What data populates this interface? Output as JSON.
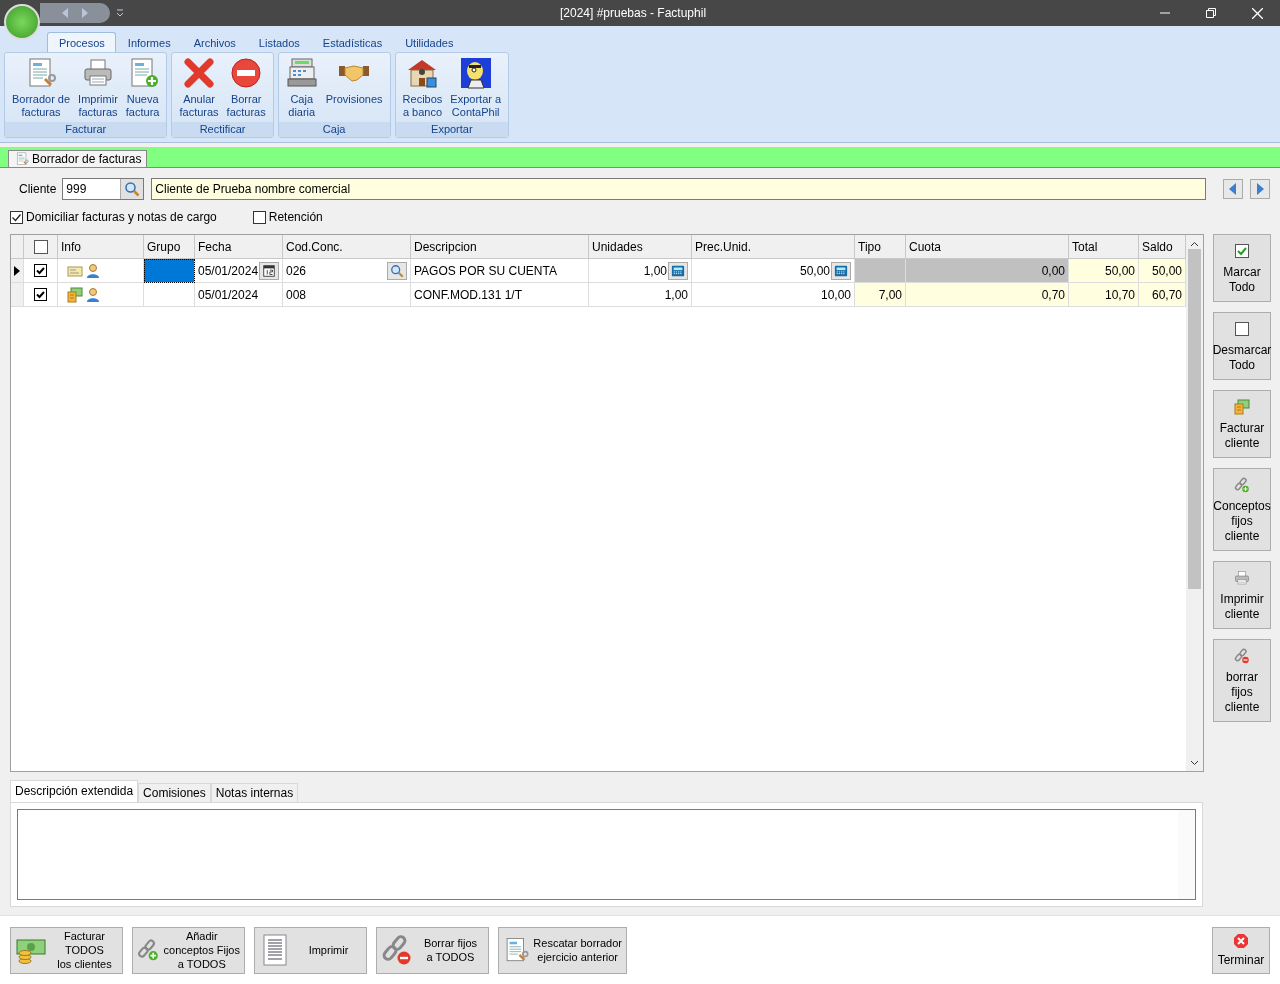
{
  "window": {
    "title": "[2024] #pruebas - Factuphil"
  },
  "ribbon": {
    "tabs": [
      {
        "label": "Procesos",
        "selected": true
      },
      {
        "label": "Informes",
        "selected": false
      },
      {
        "label": "Archivos",
        "selected": false
      },
      {
        "label": "Listados",
        "selected": false
      },
      {
        "label": "Estadísticas",
        "selected": false
      },
      {
        "label": "Utilidades",
        "selected": false
      }
    ],
    "groups": [
      {
        "label": "Facturar",
        "buttons": [
          {
            "label": "Borrador de\nfacturas",
            "kind": "draft"
          },
          {
            "label": "Imprimir\nfacturas",
            "kind": "printer"
          },
          {
            "label": "Nueva\nfactura",
            "kind": "newdoc"
          }
        ]
      },
      {
        "label": "Rectificar",
        "buttons": [
          {
            "label": "Anular\nfacturas",
            "kind": "cross"
          },
          {
            "label": "Borrar\nfacturas",
            "kind": "minus"
          }
        ]
      },
      {
        "label": "Caja",
        "buttons": [
          {
            "label": "Caja\ndiaria",
            "kind": "register"
          },
          {
            "label": "Provisiones",
            "kind": "handshake"
          }
        ]
      },
      {
        "label": "Exportar",
        "buttons": [
          {
            "label": "Recibos\na banco",
            "kind": "bank"
          },
          {
            "label": "Exportar a\nContaPhil",
            "kind": "mascot"
          }
        ]
      }
    ]
  },
  "document_tab": {
    "label": "Borrador de facturas"
  },
  "client": {
    "label": "Cliente",
    "code": "999",
    "name": "Cliente de Prueba nombre comercial"
  },
  "options": [
    {
      "label": "Domiciliar facturas y notas de cargo",
      "checked": true
    },
    {
      "label": "Retención",
      "checked": false
    }
  ],
  "table": {
    "header_checked": false,
    "columns": [
      "Info",
      "Grupo",
      "Fecha",
      "Cod.Conc.",
      "Descripcion",
      "Unidades",
      "Prec.Unid.",
      "Tipo",
      "Cuota",
      "Total",
      "Saldo"
    ],
    "rows": [
      {
        "current": true,
        "checked": true,
        "kind": "card",
        "grupo_selected": true,
        "fecha": "05/01/2024",
        "cod": "026",
        "descripcion": "PAGOS POR SU CUENTA",
        "unidades": "1,00",
        "prec": "50,00",
        "cuota": "0,00",
        "total": "50,00",
        "saldo": "50,00",
        "editing": true
      },
      {
        "current": false,
        "checked": true,
        "kind": "bills",
        "grupo_selected": false,
        "fecha": "05/01/2024",
        "cod": "008",
        "descripcion": "CONF.MOD.131 1/T",
        "unidades": "1,00",
        "prec": "10,00",
        "tipo": "7,00",
        "cuota": "0,70",
        "total": "10,70",
        "saldo": "60,70",
        "editing": false
      }
    ]
  },
  "side_buttons": [
    {
      "label": "Marcar\nTodo",
      "kind": "checked"
    },
    {
      "label": "Desmarcar\nTodo",
      "kind": "unchecked"
    },
    {
      "label": "Facturar\ncliente",
      "kind": "bills"
    },
    {
      "label": "Conceptos\nfijos\ncliente",
      "kind": "chainplus"
    },
    {
      "label": "Imprimir\ncliente",
      "kind": "printer"
    },
    {
      "label": "borrar\nfijos\ncliente",
      "kind": "chainminus"
    }
  ],
  "bottom_tabs": [
    {
      "label": "Descripción extendida",
      "selected": true
    },
    {
      "label": "Comisiones",
      "selected": false
    },
    {
      "label": "Notas internas",
      "selected": false
    }
  ],
  "footer_buttons": [
    {
      "label": "Facturar\nTODOS\nlos clientes",
      "kind": "money"
    },
    {
      "label": "Añadir\nconceptos Fijos\na TODOS",
      "kind": "chainplus"
    },
    {
      "label": "Imprimir",
      "kind": "list"
    },
    {
      "label": "Borrar fijos\na TODOS",
      "kind": "chainminus"
    },
    {
      "label": "Rescatar borrador\nejercicio anterior",
      "kind": "draft"
    }
  ],
  "exit_button": {
    "label": "Terminar"
  }
}
